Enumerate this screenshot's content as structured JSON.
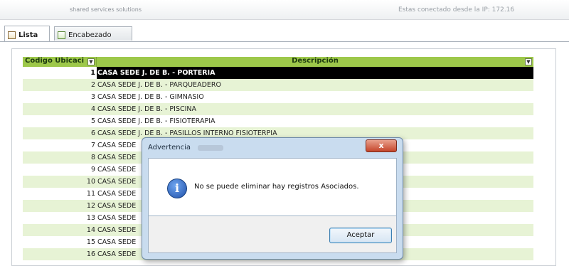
{
  "header": {
    "left_text": "shared services solutions",
    "right_text": "Estas conectado desde la IP: 172.16"
  },
  "tabs": [
    {
      "label": "Lista",
      "active": true,
      "icon": "grid-icon"
    },
    {
      "label": "Encabezado",
      "active": false,
      "icon": "form-icon"
    }
  ],
  "grid": {
    "columns": [
      "Codigo Ubicaci",
      "Descripción"
    ],
    "rows": [
      {
        "code": "1",
        "desc": "CASA SEDE J. DE B. - PORTERIA",
        "selected": true
      },
      {
        "code": "2",
        "desc": "CASA SEDE J. DE B. - PARQUEADERO"
      },
      {
        "code": "3",
        "desc": "CASA SEDE J. DE B. - GIMNASIO"
      },
      {
        "code": "4",
        "desc": "CASA SEDE J. DE B. - PISCINA"
      },
      {
        "code": "5",
        "desc": "CASA SEDE J. DE B. - FISIOTERAPIA"
      },
      {
        "code": "6",
        "desc": "CASA SEDE J. DE B. - PASILLOS INTERNO FISIOTERPIA"
      },
      {
        "code": "7",
        "desc": "CASA SEDE"
      },
      {
        "code": "8",
        "desc": "CASA SEDE"
      },
      {
        "code": "9",
        "desc": "CASA SEDE"
      },
      {
        "code": "10",
        "desc": "CASA SEDE"
      },
      {
        "code": "11",
        "desc": "CASA SEDE"
      },
      {
        "code": "12",
        "desc": "CASA SEDE"
      },
      {
        "code": "13",
        "desc": "CASA SEDE"
      },
      {
        "code": "14",
        "desc": "CASA SEDE"
      },
      {
        "code": "15",
        "desc": "CASA SEDE"
      },
      {
        "code": "16",
        "desc": "CASA SEDE"
      }
    ]
  },
  "dialog": {
    "title": "Advertencia",
    "message": "No se puede eliminar hay registros Asociados.",
    "ok_label": "Aceptar",
    "close_glyph": "x",
    "icon_glyph": "i"
  }
}
